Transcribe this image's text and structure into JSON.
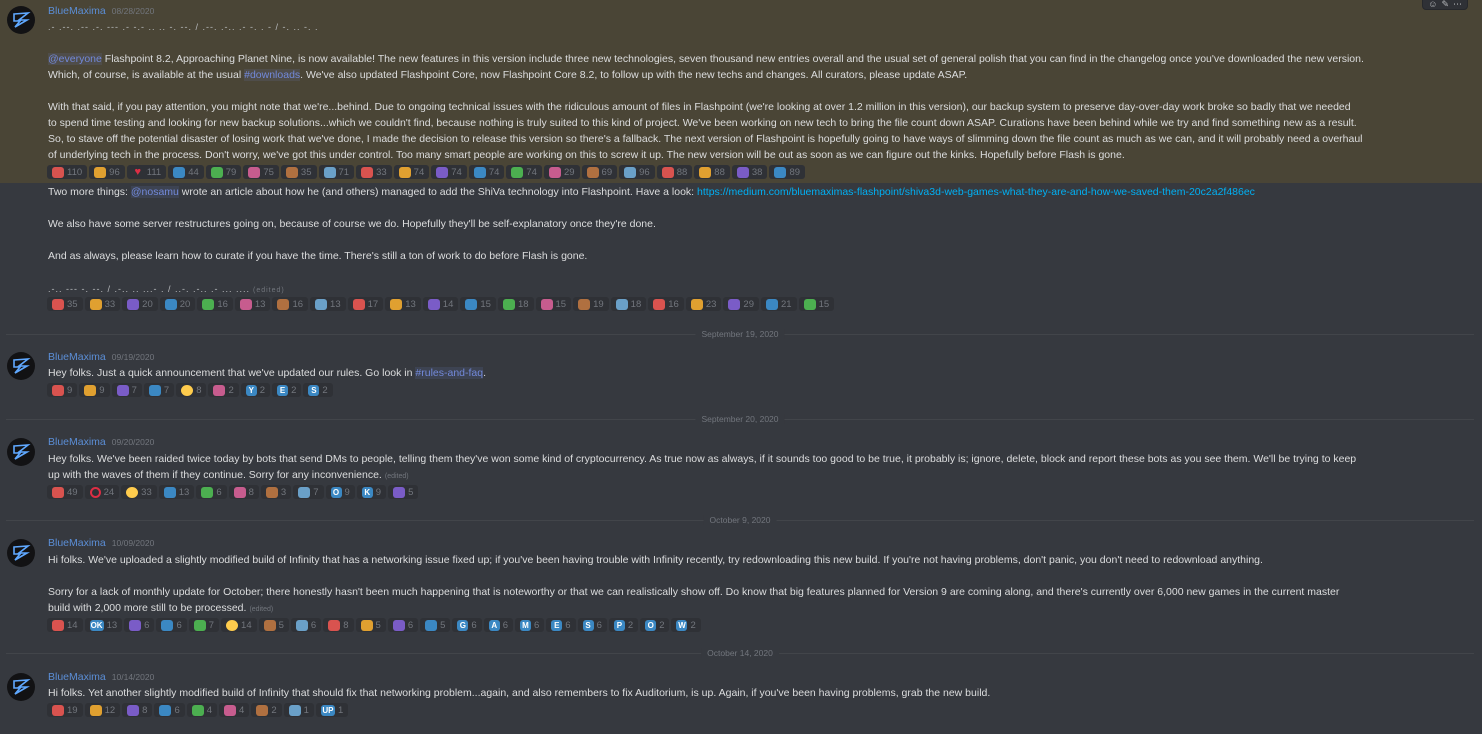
{
  "colors": {
    "background": "#36393f",
    "highlight": "#4a4536",
    "author": "#5b8ed6",
    "mention": "#7289da",
    "link": "#00b0f4",
    "reaction_bg": "#2f3136"
  },
  "toolbar": {
    "icons": [
      "add-reaction-icon",
      "edit-icon",
      "more-icon"
    ]
  },
  "edited_label": "(edited)",
  "msg1": {
    "author": "BlueMaxima",
    "timestamp": "08/28/2020",
    "deco_top": ".- .--. .-- .-. --- .- -.- .. .. -. --. / .--. .-.. .- -. . - / -. .. -. .",
    "p1_mention": "@everyone",
    "p1_a": " Flashpoint 8.2, Approaching Planet Nine, is now available! The new features in this version include three new technologies, seven thousand new entries overall and the usual set of general polish that you can find in the changelog once you've downloaded the new version.",
    "p1_b": "Which, of course, is available at the usual ",
    "p1_channel": "#downloads",
    "p1_c": ". We've also updated Flashpoint Core, now Flashpoint Core 8.2, to follow up with the new techs and changes. All curators, please update ASAP.",
    "p2_l1": "With that said, if you pay attention, you might note that we're...behind. Due to ongoing technical issues with the ridiculous amount of files in Flashpoint (we're looking at over 1.2 million in this version), our backup system to preserve day-over-day work broke so badly that we needed",
    "p2_l2": "to spend time testing and looking for new backup solutions...which we couldn't find, because nothing is truly suited to this kind of project. We've been working on new tech to bring the file count down ASAP. Curations have been behind while we try and find something new as a result.",
    "p2_l3": "So, to stave off the potential disaster of losing work that we've done, I made the decision to release this version so there's a fallback. The next version of Flashpoint is hopefully going to have ways of slimming down the file count as much as we can, and it will probably need a overhaul",
    "p2_l4": "of underlying tech in the process. Don't worry, we've got this under control. Too many smart people are working on this to screw it up. The new version will be out as soon as we can figure out the kinks. Hopefully before Flash is gone.",
    "reactions": [
      {
        "icon": "pray-emoji",
        "count": "110"
      },
      {
        "icon": "custom-emoji",
        "count": "96"
      },
      {
        "icon": "heart-emoji",
        "count": "111"
      },
      {
        "icon": "custom-emoji",
        "count": "44"
      },
      {
        "icon": "custom-emoji",
        "count": "79"
      },
      {
        "icon": "custom-emoji",
        "count": "75"
      },
      {
        "icon": "custom-emoji",
        "count": "35"
      },
      {
        "icon": "custom-emoji",
        "count": "71"
      },
      {
        "icon": "custom-emoji",
        "count": "33"
      },
      {
        "icon": "custom-emoji",
        "count": "74"
      },
      {
        "icon": "custom-emoji",
        "count": "74"
      },
      {
        "icon": "custom-emoji",
        "count": "74"
      },
      {
        "icon": "custom-emoji",
        "count": "74"
      },
      {
        "icon": "custom-emoji",
        "count": "29"
      },
      {
        "icon": "custom-emoji",
        "count": "69"
      },
      {
        "icon": "custom-emoji",
        "count": "96"
      },
      {
        "icon": "custom-emoji",
        "count": "88"
      },
      {
        "icon": "custom-emoji",
        "count": "88"
      },
      {
        "icon": "custom-emoji",
        "count": "38"
      },
      {
        "icon": "custom-emoji",
        "count": "89"
      }
    ],
    "more_a": "Two more things: ",
    "more_mention": "@nosamu",
    "more_b": " wrote an article about how he (and others) managed to add the ShiVa technology into Flashpoint. Have a look: ",
    "more_link": "https://medium.com/bluemaximas-flashpoint/shiva3d-web-games-what-they-are-and-how-we-saved-them-20c2a2f486ec",
    "servers": "We also have some server restructures going on, because of course we do. Hopefully they'll be self-explanatory once they're done.",
    "always": "And as always, please learn how to curate if you have the time. There's still a ton of work to do before Flash is gone.",
    "deco_bottom": ".-.. --- -. --. / .-.. .. ...- . / ..-. .-.. .- ... ....",
    "reactions2": [
      {
        "icon": "custom-emoji",
        "count": "35"
      },
      {
        "icon": "custom-emoji",
        "count": "33"
      },
      {
        "icon": "custom-emoji",
        "count": "20"
      },
      {
        "icon": "custom-emoji",
        "count": "20"
      },
      {
        "icon": "custom-emoji",
        "count": "16"
      },
      {
        "icon": "custom-emoji",
        "count": "13"
      },
      {
        "icon": "custom-emoji",
        "count": "16"
      },
      {
        "icon": "custom-emoji",
        "count": "13"
      },
      {
        "icon": "custom-emoji",
        "count": "17"
      },
      {
        "icon": "custom-emoji",
        "count": "13"
      },
      {
        "icon": "custom-emoji",
        "count": "14"
      },
      {
        "icon": "custom-emoji",
        "count": "15"
      },
      {
        "icon": "custom-emoji",
        "count": "18"
      },
      {
        "icon": "custom-emoji",
        "count": "15"
      },
      {
        "icon": "custom-emoji",
        "count": "19"
      },
      {
        "icon": "custom-emoji",
        "count": "18"
      },
      {
        "icon": "custom-emoji",
        "count": "16"
      },
      {
        "icon": "custom-emoji",
        "count": "23"
      },
      {
        "icon": "ok-hand-emoji",
        "count": "29"
      },
      {
        "icon": "vulcan-emoji",
        "count": "21"
      },
      {
        "icon": "custom-emoji",
        "count": "15"
      }
    ]
  },
  "divider1": "September 19, 2020",
  "msg2": {
    "author": "BlueMaxima",
    "timestamp": "09/19/2020",
    "text_a": "Hey folks. Just a quick announcement that we've updated our rules. Go look in ",
    "channel": "#rules-and-faq",
    "text_b": ".",
    "reactions": [
      {
        "icon": "custom-emoji",
        "count": "9"
      },
      {
        "icon": "custom-emoji",
        "count": "9"
      },
      {
        "icon": "heart-eyes-emoji",
        "count": "7"
      },
      {
        "icon": "custom-emoji",
        "count": "7"
      },
      {
        "icon": "thumbs-up-emoji",
        "count": "8"
      },
      {
        "icon": "custom-emoji",
        "count": "2"
      },
      {
        "icon": "letter-y-emoji",
        "letter": "Y",
        "count": "2"
      },
      {
        "icon": "letter-e-emoji",
        "letter": "E",
        "count": "2"
      },
      {
        "icon": "letter-s-emoji",
        "letter": "S",
        "count": "2"
      }
    ]
  },
  "divider2": "September 20, 2020",
  "msg3": {
    "author": "BlueMaxima",
    "timestamp": "09/20/2020",
    "line1": "Hey folks. We've been raided twice today by bots that send DMs to people, telling them they've won some kind of cryptocurrency. As true now as always, if it sounds too good to be true, it probably is; ignore, delete, block and report these bots as you see them. We'll be trying to keep",
    "line2": "up with the waves of them if they continue. Sorry for any inconvenience.",
    "reactions": [
      {
        "icon": "custom-emoji",
        "count": "49"
      },
      {
        "icon": "no-entry-emoji",
        "count": "24"
      },
      {
        "icon": "thumbs-up-emoji",
        "count": "33"
      },
      {
        "icon": "custom-emoji",
        "count": "13"
      },
      {
        "icon": "custom-emoji",
        "count": "6"
      },
      {
        "icon": "custom-emoji",
        "count": "8"
      },
      {
        "icon": "custom-emoji",
        "count": "3"
      },
      {
        "icon": "custom-emoji",
        "count": "7"
      },
      {
        "icon": "letter-o-emoji",
        "letter": "O",
        "count": "9"
      },
      {
        "icon": "letter-k-emoji",
        "letter": "K",
        "count": "9"
      },
      {
        "icon": "custom-emoji",
        "count": "5"
      }
    ]
  },
  "divider3": "October 9, 2020",
  "msg4": {
    "author": "BlueMaxima",
    "timestamp": "10/09/2020",
    "line1": "Hi folks. We've uploaded a slightly modified build of Infinity that has a networking issue fixed up; if you've been having trouble with Infinity recently, try redownloading this new build. If you're not having problems, don't panic, you don't need to redownload anything.",
    "line2": "Sorry for a lack of monthly update for October; there honestly hasn't been much happening that is noteworthy or that we can realistically show off. Do know that big features planned for Version 9 are coming along, and there's currently over 6,000 new games in the current master",
    "line3": "build with 2,000 more still to be processed.",
    "reactions": [
      {
        "icon": "custom-emoji",
        "count": "14"
      },
      {
        "icon": "ok-button-emoji",
        "letter": "OK",
        "count": "13"
      },
      {
        "icon": "custom-emoji",
        "count": "6"
      },
      {
        "icon": "custom-emoji",
        "count": "6"
      },
      {
        "icon": "custom-emoji",
        "count": "7"
      },
      {
        "icon": "thumbs-up-emoji",
        "count": "14"
      },
      {
        "icon": "custom-emoji",
        "count": "5"
      },
      {
        "icon": "custom-emoji",
        "count": "6"
      },
      {
        "icon": "custom-emoji",
        "count": "8"
      },
      {
        "icon": "custom-emoji",
        "count": "5"
      },
      {
        "icon": "custom-emoji",
        "count": "6"
      },
      {
        "icon": "custom-emoji",
        "count": "5"
      },
      {
        "icon": "letter-g-emoji",
        "letter": "G",
        "count": "6"
      },
      {
        "icon": "letter-a-emoji",
        "letter": "A",
        "count": "6"
      },
      {
        "icon": "letter-m-emoji",
        "letter": "M",
        "count": "6"
      },
      {
        "icon": "letter-e-emoji",
        "letter": "E",
        "count": "6"
      },
      {
        "icon": "letter-s-emoji",
        "letter": "S",
        "count": "6"
      },
      {
        "icon": "letter-p-emoji",
        "letter": "P",
        "count": "2"
      },
      {
        "icon": "letter-o-emoji",
        "letter": "O",
        "count": "2"
      },
      {
        "icon": "letter-w-emoji",
        "letter": "W",
        "count": "2"
      }
    ]
  },
  "divider4": "October 14, 2020",
  "msg5": {
    "author": "BlueMaxima",
    "timestamp": "10/14/2020",
    "line1": "Hi folks. Yet another slightly modified build of Infinity that should fix that networking problem...again, and also remembers to fix Auditorium, is up. Again, if you've been having problems, grab the new build.",
    "reactions": [
      {
        "icon": "custom-emoji",
        "count": "19"
      },
      {
        "icon": "custom-emoji",
        "count": "12"
      },
      {
        "icon": "custom-emoji",
        "count": "8"
      },
      {
        "icon": "custom-emoji",
        "count": "6"
      },
      {
        "icon": "custom-emoji",
        "count": "4"
      },
      {
        "icon": "custom-emoji",
        "count": "4"
      },
      {
        "icon": "custom-emoji",
        "count": "2"
      },
      {
        "icon": "custom-emoji",
        "count": "1"
      },
      {
        "icon": "up-button-emoji",
        "letter": "UP",
        "count": "1"
      }
    ]
  }
}
